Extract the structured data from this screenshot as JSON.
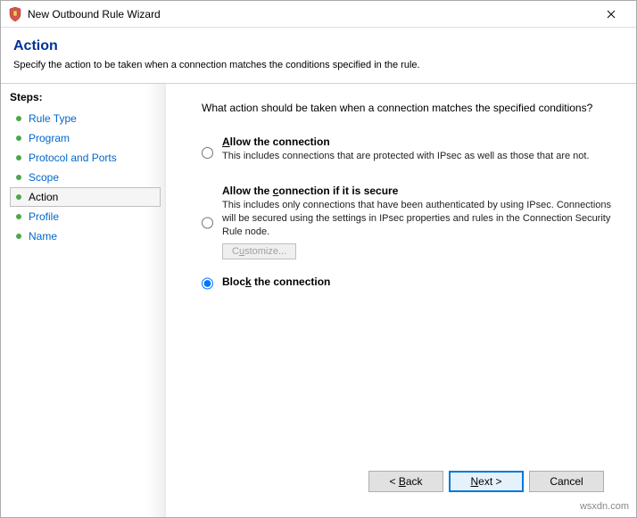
{
  "window": {
    "title": "New Outbound Rule Wizard"
  },
  "header": {
    "title": "Action",
    "subtitle": "Specify the action to be taken when a connection matches the conditions specified in the rule."
  },
  "steps": {
    "label": "Steps:",
    "items": [
      {
        "label": "Rule Type",
        "current": false
      },
      {
        "label": "Program",
        "current": false
      },
      {
        "label": "Protocol and Ports",
        "current": false
      },
      {
        "label": "Scope",
        "current": false
      },
      {
        "label": "Action",
        "current": true
      },
      {
        "label": "Profile",
        "current": false
      },
      {
        "label": "Name",
        "current": false
      }
    ]
  },
  "content": {
    "prompt": "What action should be taken when a connection matches the specified conditions?",
    "options": {
      "allow": {
        "title_pre": "",
        "title_u": "A",
        "title_post": "llow the connection",
        "desc": "This includes connections that are protected with IPsec as well as those that are not."
      },
      "allow_secure": {
        "title_pre": "Allow the ",
        "title_u": "c",
        "title_post": "onnection if it is secure",
        "desc": "This includes only connections that have been authenticated by using IPsec. Connections will be secured using the settings in IPsec properties and rules in the Connection Security Rule node.",
        "customize_pre": "C",
        "customize_u": "u",
        "customize_post": "stomize..."
      },
      "block": {
        "title_pre": "Bloc",
        "title_u": "k",
        "title_post": " the connection"
      }
    },
    "selected": "block"
  },
  "footer": {
    "back_pre": "< ",
    "back_u": "B",
    "back_post": "ack",
    "next_u": "N",
    "next_post": "ext >",
    "cancel": "Cancel"
  },
  "watermark": "wsxdn.com"
}
